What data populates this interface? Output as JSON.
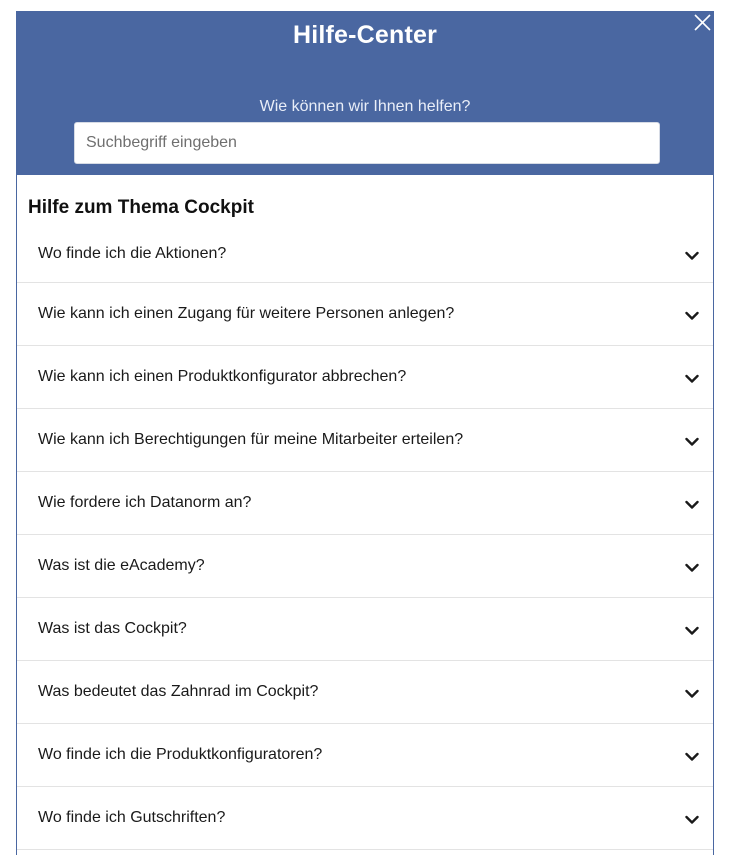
{
  "header": {
    "title": "Hilfe-Center",
    "subtitle": "Wie können wir Ihnen helfen?",
    "close_icon": "close-icon",
    "color": "#4a67a1"
  },
  "search": {
    "placeholder": "Suchbegriff eingeben",
    "value": ""
  },
  "section": {
    "title": "Hilfe zum Thema Cockpit"
  },
  "faq": {
    "expand_icon": "chevron-down-icon",
    "items": [
      {
        "question": "Wo finde ich die Aktionen?"
      },
      {
        "question": "Wie kann ich einen Zugang für weitere Personen anlegen?"
      },
      {
        "question": "Wie kann ich einen Produktkonfigurator abbrechen?"
      },
      {
        "question": "Wie kann ich Berechtigungen für meine Mitarbeiter erteilen?"
      },
      {
        "question": "Wie fordere ich Datanorm an?"
      },
      {
        "question": "Was ist die eAcademy?"
      },
      {
        "question": "Was ist das Cockpit?"
      },
      {
        "question": "Was bedeutet das Zahnrad im Cockpit?"
      },
      {
        "question": "Wo finde ich die Produktkonfiguratoren?"
      },
      {
        "question": "Wo finde ich Gutschriften?"
      }
    ]
  }
}
